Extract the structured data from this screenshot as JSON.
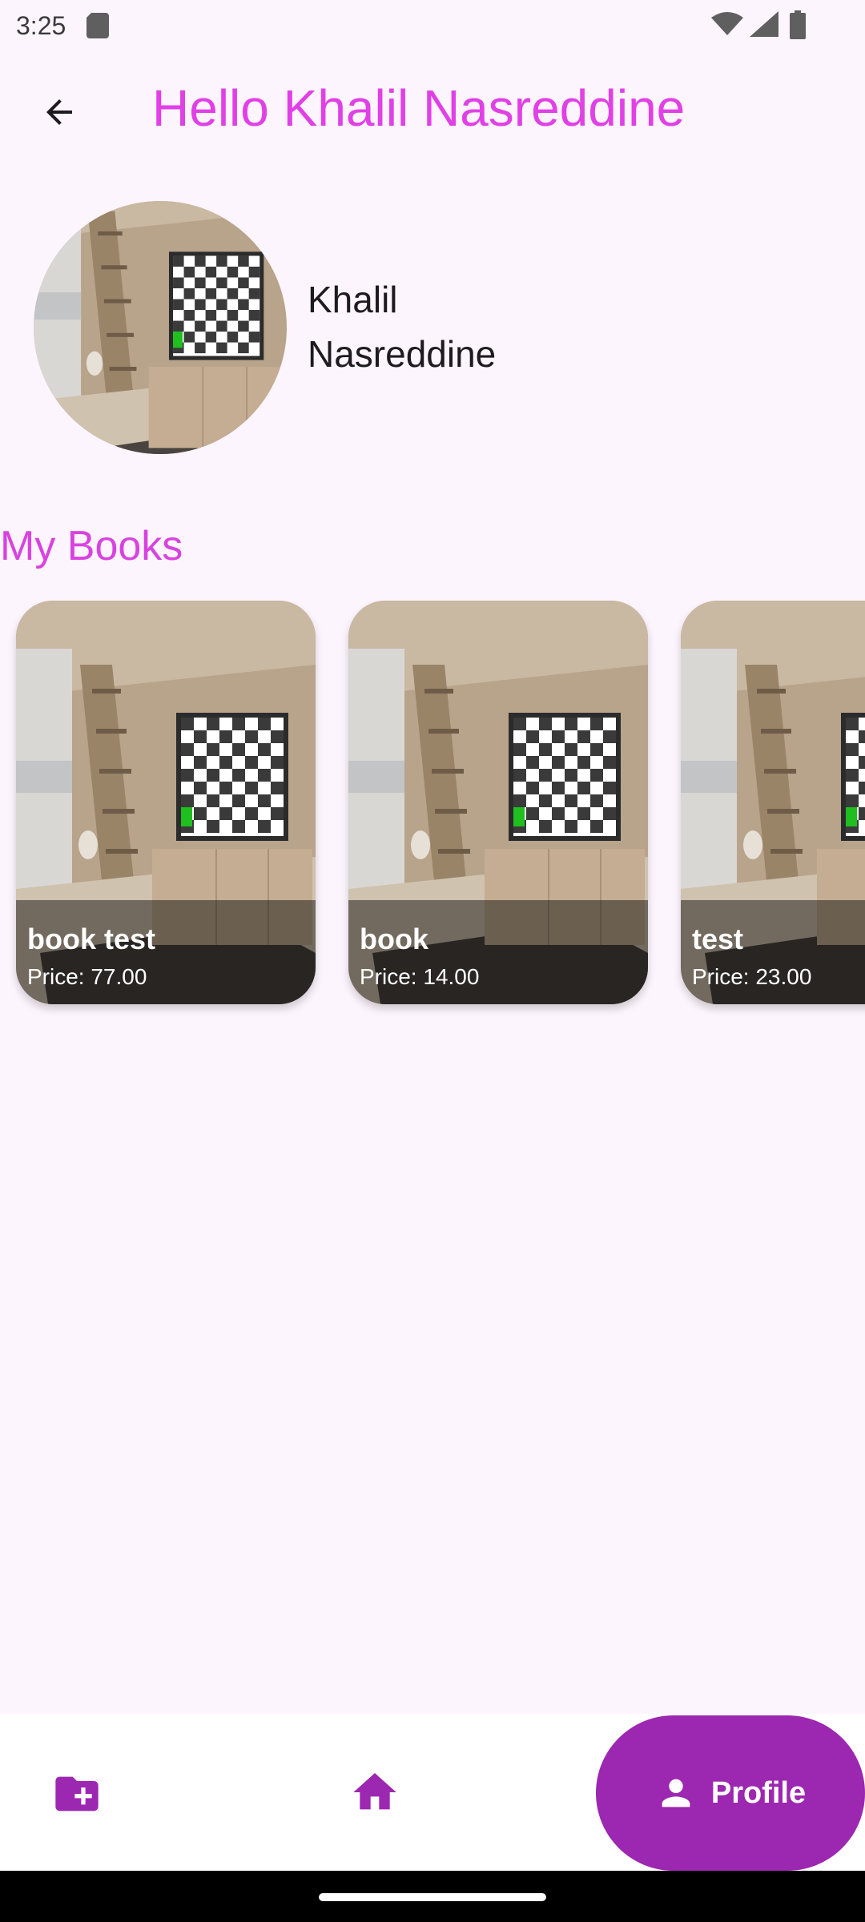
{
  "status_bar": {
    "time": "3:25"
  },
  "header": {
    "title": "Hello Khalil Nasreddine"
  },
  "profile": {
    "first_name": "Khalil",
    "last_name": "Nasreddine"
  },
  "books": {
    "title": "My Books",
    "items": [
      {
        "title": "book test",
        "price": "Price: 77.00"
      },
      {
        "title": "book",
        "price": "Price: 14.00"
      },
      {
        "title": "test",
        "price": "Price: 23.00"
      }
    ]
  },
  "bottom_nav": {
    "items": [
      {
        "icon": "create-folder-icon"
      },
      {
        "icon": "home-icon"
      },
      {
        "icon": "person-icon",
        "label": "Profile",
        "selected": true
      }
    ]
  },
  "colors": {
    "accent": "#e040e6",
    "nav_active": "#9c27b0",
    "background": "#fdf5fd"
  }
}
